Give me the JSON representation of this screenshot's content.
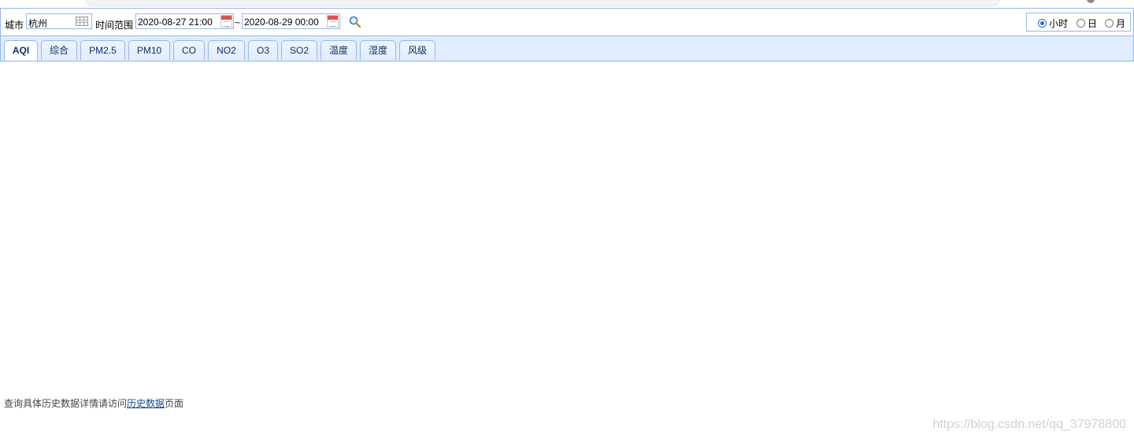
{
  "toolbar": {
    "city_label": "城市",
    "city_value": "杭州",
    "time_range_label": "时间范围",
    "start_time": "2020-08-27 21:00",
    "separator": "~",
    "end_time": "2020-08-29 00:00",
    "granularity": [
      {
        "label": "小时",
        "checked": true
      },
      {
        "label": "日",
        "checked": false
      },
      {
        "label": "月",
        "checked": false
      }
    ]
  },
  "tabs": [
    {
      "label": "AQI",
      "active": true
    },
    {
      "label": "综合"
    },
    {
      "label": "PM2.5"
    },
    {
      "label": "PM10"
    },
    {
      "label": "CO"
    },
    {
      "label": "NO2"
    },
    {
      "label": "O3"
    },
    {
      "label": "SO2"
    },
    {
      "label": "温度"
    },
    {
      "label": "湿度"
    },
    {
      "label": "风级"
    }
  ],
  "footer": {
    "prefix": "查询具体历史数据详情请访问",
    "link": "历史数据",
    "suffix": "页面"
  },
  "watermark": "https://blog.csdn.net/qq_37978800",
  "colors": {
    "border": "#95b8e7",
    "tab_bg": "#e0ecff",
    "radio_accent": "#2a6ad4"
  }
}
